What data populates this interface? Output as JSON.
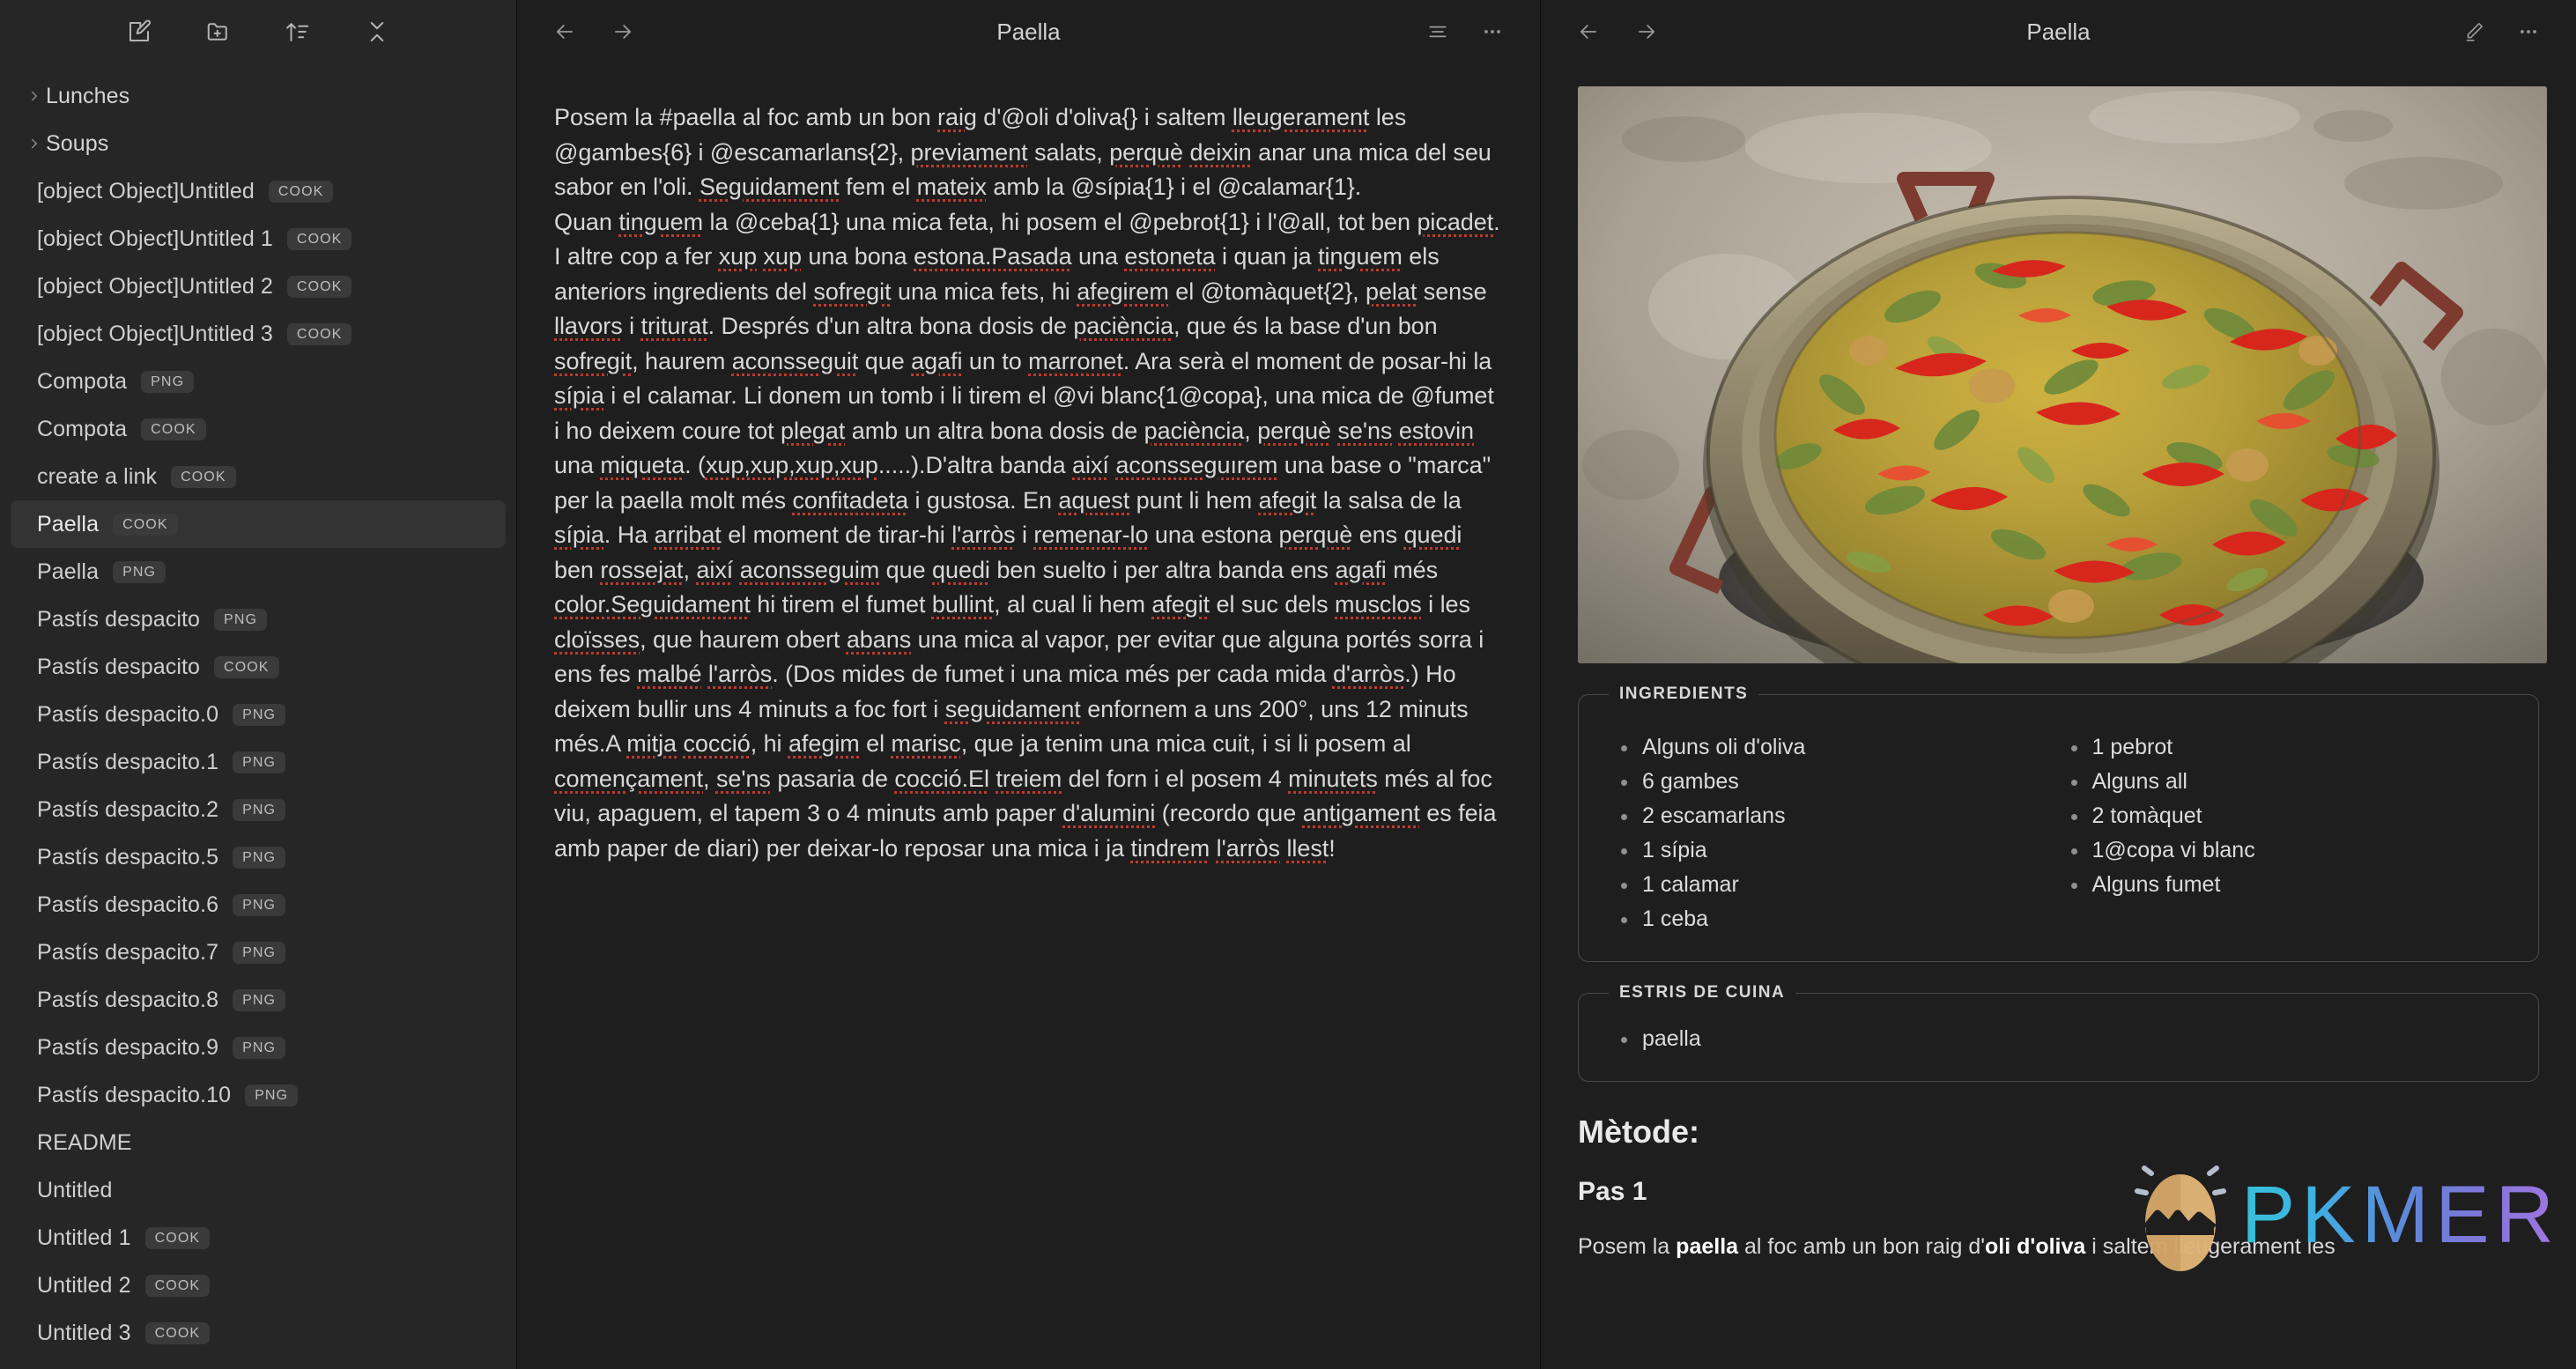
{
  "sidebar": {
    "toolbar": [
      {
        "name": "new-note-icon",
        "label": "New note"
      },
      {
        "name": "new-folder-icon",
        "label": "New folder"
      },
      {
        "name": "sort-icon",
        "label": "Change sort order"
      },
      {
        "name": "collapse-all-icon",
        "label": "Collapse all"
      }
    ],
    "items": [
      {
        "label": "Lunches",
        "type": "folder",
        "badge": "",
        "selected": false
      },
      {
        "label": "Soups",
        "type": "folder",
        "badge": "",
        "selected": false
      },
      {
        "label": "[object Object]Untitled",
        "type": "file",
        "badge": "COOK",
        "selected": false
      },
      {
        "label": "[object Object]Untitled 1",
        "type": "file",
        "badge": "COOK",
        "selected": false
      },
      {
        "label": "[object Object]Untitled 2",
        "type": "file",
        "badge": "COOK",
        "selected": false
      },
      {
        "label": "[object Object]Untitled 3",
        "type": "file",
        "badge": "COOK",
        "selected": false
      },
      {
        "label": "Compota",
        "type": "file",
        "badge": "PNG",
        "selected": false
      },
      {
        "label": "Compota",
        "type": "file",
        "badge": "COOK",
        "selected": false
      },
      {
        "label": "create a link",
        "type": "file",
        "badge": "COOK",
        "selected": false
      },
      {
        "label": "Paella",
        "type": "file",
        "badge": "COOK",
        "selected": true
      },
      {
        "label": "Paella",
        "type": "file",
        "badge": "PNG",
        "selected": false
      },
      {
        "label": "Pastís despacito",
        "type": "file",
        "badge": "PNG",
        "selected": false
      },
      {
        "label": "Pastís despacito",
        "type": "file",
        "badge": "COOK",
        "selected": false
      },
      {
        "label": "Pastís despacito.0",
        "type": "file",
        "badge": "PNG",
        "selected": false
      },
      {
        "label": "Pastís despacito.1",
        "type": "file",
        "badge": "PNG",
        "selected": false
      },
      {
        "label": "Pastís despacito.2",
        "type": "file",
        "badge": "PNG",
        "selected": false
      },
      {
        "label": "Pastís despacito.5",
        "type": "file",
        "badge": "PNG",
        "selected": false
      },
      {
        "label": "Pastís despacito.6",
        "type": "file",
        "badge": "PNG",
        "selected": false
      },
      {
        "label": "Pastís despacito.7",
        "type": "file",
        "badge": "PNG",
        "selected": false
      },
      {
        "label": "Pastís despacito.8",
        "type": "file",
        "badge": "PNG",
        "selected": false
      },
      {
        "label": "Pastís despacito.9",
        "type": "file",
        "badge": "PNG",
        "selected": false
      },
      {
        "label": "Pastís despacito.10",
        "type": "file",
        "badge": "PNG",
        "selected": false
      },
      {
        "label": "README",
        "type": "file",
        "badge": "",
        "selected": false
      },
      {
        "label": "Untitled",
        "type": "file",
        "badge": "",
        "selected": false
      },
      {
        "label": "Untitled 1",
        "type": "file",
        "badge": "COOK",
        "selected": false
      },
      {
        "label": "Untitled 2",
        "type": "file",
        "badge": "COOK",
        "selected": false
      },
      {
        "label": "Untitled 3",
        "type": "file",
        "badge": "COOK",
        "selected": false
      }
    ]
  },
  "editor": {
    "title": "Paella",
    "back_label": "Back",
    "forward_label": "Forward",
    "list_label": "Reading view options",
    "more_label": "More options",
    "paragraphs": [
      [
        {
          "t": "Posem la #paella al foc amb un bon "
        },
        {
          "t": "raig",
          "sp": true
        },
        {
          "t": " d'@oli d'oliva{} i saltem "
        },
        {
          "t": "lleugerament",
          "sp": true
        },
        {
          "t": " les @gambes{6} i @escamarlans{2}, "
        },
        {
          "t": "previament",
          "sp": true
        },
        {
          "t": " salats, "
        },
        {
          "t": "perquè",
          "sp": true
        },
        {
          "t": " "
        },
        {
          "t": "deixin",
          "sp": true
        },
        {
          "t": " anar una mica del seu sabor en l'oli. "
        },
        {
          "t": "Seguidament",
          "sp": true
        },
        {
          "t": " fem el "
        },
        {
          "t": "mateix",
          "sp": true
        },
        {
          "t": " amb la @sípia{1} i el @calamar{1}."
        }
      ],
      [
        {
          "t": "Quan "
        },
        {
          "t": "tinguem",
          "sp": true
        },
        {
          "t": " la @ceba{1} una mica feta, hi posem el @pebrot{1} i l'@all, tot ben "
        },
        {
          "t": "picadet",
          "sp": true
        },
        {
          "t": ". I altre cop a fer "
        },
        {
          "t": "xup",
          "sp": true
        },
        {
          "t": " "
        },
        {
          "t": "xup",
          "sp": true
        },
        {
          "t": " una bona "
        },
        {
          "t": "estona.Pasada",
          "sp": true
        },
        {
          "t": " una "
        },
        {
          "t": "estoneta",
          "sp": true
        },
        {
          "t": " i quan ja "
        },
        {
          "t": "tinguem",
          "sp": true
        },
        {
          "t": " els anteriors ingredients del "
        },
        {
          "t": "sofregit",
          "sp": true
        },
        {
          "t": " una mica fets, hi "
        },
        {
          "t": "afegirem",
          "sp": true
        },
        {
          "t": " el @tomàquet{2}, "
        },
        {
          "t": "pelat",
          "sp": true
        },
        {
          "t": " sense "
        },
        {
          "t": "llavors",
          "sp": true
        },
        {
          "t": " i "
        },
        {
          "t": "triturat",
          "sp": true
        },
        {
          "t": ". Després d'un altra bona dosis de "
        },
        {
          "t": "paciència",
          "sp": true
        },
        {
          "t": ", que és la base d'un bon "
        },
        {
          "t": "sofregit",
          "sp": true
        },
        {
          "t": ", haurem "
        },
        {
          "t": "aconsseguit",
          "sp": true
        },
        {
          "t": " que "
        },
        {
          "t": "agafi",
          "sp": true
        },
        {
          "t": " un to "
        },
        {
          "t": "marronet",
          "sp": true
        },
        {
          "t": ". Ara serà el moment de posar-hi la "
        },
        {
          "t": "sípia",
          "sp": true
        },
        {
          "t": " i el calamar. Li donem un tomb i li tirem el @vi blanc{1@copa}, una mica de @fumet i ho deixem coure tot "
        },
        {
          "t": "plegat",
          "sp": true
        },
        {
          "t": " amb un altra bona dosis de "
        },
        {
          "t": "paciència",
          "sp": true
        },
        {
          "t": ", "
        },
        {
          "t": "perquè",
          "sp": true
        },
        {
          "t": " "
        },
        {
          "t": "se'ns",
          "sp": true
        },
        {
          "t": " "
        },
        {
          "t": "estovin",
          "sp": true
        },
        {
          "t": " una "
        },
        {
          "t": "miqueta",
          "sp": true
        },
        {
          "t": ". ("
        },
        {
          "t": "xup,xup,xup,xup",
          "sp": true
        },
        {
          "t": ".....).D'altra banda "
        },
        {
          "t": "així",
          "sp": true
        },
        {
          "t": " "
        },
        {
          "t": "aconsseguırem",
          "sp": true
        },
        {
          "t": " una base o \"marca\" per la paella molt més "
        },
        {
          "t": "confitadeta",
          "sp": true
        },
        {
          "t": " i gustosa. En "
        },
        {
          "t": "aquest",
          "sp": true
        },
        {
          "t": " punt li hem "
        },
        {
          "t": "afegit",
          "sp": true
        },
        {
          "t": " la salsa de la "
        },
        {
          "t": "sípia",
          "sp": true
        },
        {
          "t": ". Ha "
        },
        {
          "t": "arribat",
          "sp": true
        },
        {
          "t": " el moment de tirar-hi "
        },
        {
          "t": "l'arròs",
          "sp": true
        },
        {
          "t": " i "
        },
        {
          "t": "remenar-lo",
          "sp": true
        },
        {
          "t": " una estona "
        },
        {
          "t": "perquè",
          "sp": true
        },
        {
          "t": " ens "
        },
        {
          "t": "quedi",
          "sp": true
        },
        {
          "t": " ben "
        },
        {
          "t": "rossejat",
          "sp": true
        },
        {
          "t": ", "
        },
        {
          "t": "així",
          "sp": true
        },
        {
          "t": " "
        },
        {
          "t": "aconsseguim",
          "sp": true
        },
        {
          "t": " que "
        },
        {
          "t": "quedi",
          "sp": true
        },
        {
          "t": " ben suelto i per altra banda ens "
        },
        {
          "t": "agafi",
          "sp": true
        },
        {
          "t": " més "
        },
        {
          "t": "color.Seguidament",
          "sp": true
        },
        {
          "t": " hi tirem el fumet "
        },
        {
          "t": "bullint",
          "sp": true
        },
        {
          "t": ", al cual li hem "
        },
        {
          "t": "afegit",
          "sp": true
        },
        {
          "t": " el suc dels "
        },
        {
          "t": "musclos",
          "sp": true
        },
        {
          "t": " i les "
        },
        {
          "t": "cloïsses",
          "sp": true
        },
        {
          "t": ", que haurem obert "
        },
        {
          "t": "abans",
          "sp": true
        },
        {
          "t": " una mica al vapor, per evitar que alguna portés sorra i ens fes "
        },
        {
          "t": "malbé",
          "sp": true
        },
        {
          "t": " "
        },
        {
          "t": "l'arròs",
          "sp": true
        },
        {
          "t": ". (Dos mides de fumet i una mica més per cada mida "
        },
        {
          "t": "d'arròs",
          "sp": true
        },
        {
          "t": ".) Ho deixem bullir uns 4 minuts a foc fort i "
        },
        {
          "t": "seguidament",
          "sp": true
        },
        {
          "t": " enfornem a uns 200°, uns 12 minuts més.A "
        },
        {
          "t": "mitja",
          "sp": true
        },
        {
          "t": " "
        },
        {
          "t": "cocció",
          "sp": true
        },
        {
          "t": ", hi "
        },
        {
          "t": "afegim",
          "sp": true
        },
        {
          "t": " el "
        },
        {
          "t": "marisc",
          "sp": true
        },
        {
          "t": ", que ja tenim una mica cuit, i si li posem al "
        },
        {
          "t": "començament",
          "sp": true
        },
        {
          "t": ", "
        },
        {
          "t": "se'ns",
          "sp": true
        },
        {
          "t": " pasaria de "
        },
        {
          "t": "cocció.El",
          "sp": true
        },
        {
          "t": " "
        },
        {
          "t": "treiem",
          "sp": true
        },
        {
          "t": " del forn i el posem 4 "
        },
        {
          "t": "minutets",
          "sp": true
        },
        {
          "t": " més al foc viu, apaguem, el tapem 3 o 4 minuts amb paper "
        },
        {
          "t": "d'alumini",
          "sp": true
        },
        {
          "t": " (recordo que "
        },
        {
          "t": "antigament",
          "sp": true
        },
        {
          "t": " es feia amb paper de diari) per deixar-lo reposar una mica i ja "
        },
        {
          "t": "tindrem",
          "sp": true
        },
        {
          "t": " "
        },
        {
          "t": "l'arròs",
          "sp": true
        },
        {
          "t": " "
        },
        {
          "t": "llest",
          "sp": true
        },
        {
          "t": "!"
        }
      ]
    ]
  },
  "preview": {
    "title": "Paella",
    "back_label": "Back",
    "forward_label": "Forward",
    "edit_label": "Edit",
    "more_label": "More options",
    "photo_alt": "Paella pan cooking over embers",
    "ingredients_legend": "INGREDIENTS",
    "ingredients_col1": [
      "Alguns oli d'oliva",
      "6 gambes",
      "2 escamarlans",
      "1 sípia",
      "1 calamar",
      "1 ceba"
    ],
    "ingredients_col2": [
      "1 pebrot",
      "Alguns all",
      "2 tomàquet",
      "1@copa vi blanc",
      "Alguns fumet"
    ],
    "tools_legend": "ESTRIS DE CUINA",
    "tools": [
      "paella"
    ],
    "method_heading": "Mètode:",
    "step_heading": "Pas 1",
    "step_parts": [
      {
        "t": "Posem la "
      },
      {
        "t": "paella",
        "b": true
      },
      {
        "t": " al foc amb un bon raig d'"
      },
      {
        "t": "oli d'oliva",
        "b": true
      },
      {
        "t": " i saltem lleugerament les"
      }
    ]
  },
  "watermark": {
    "text": "PKMER",
    "icon": "egg-icon",
    "gradient_from": "#38c7e0",
    "gradient_to": "#a579e8"
  },
  "colors": {
    "sidebar_bg": "#262626",
    "pane_bg": "#1e1e1e",
    "selected_row": "#333333",
    "badge_bg": "#3a3a3a",
    "text_primary": "#d8d8d8",
    "spellcheck": "#c0392b"
  }
}
